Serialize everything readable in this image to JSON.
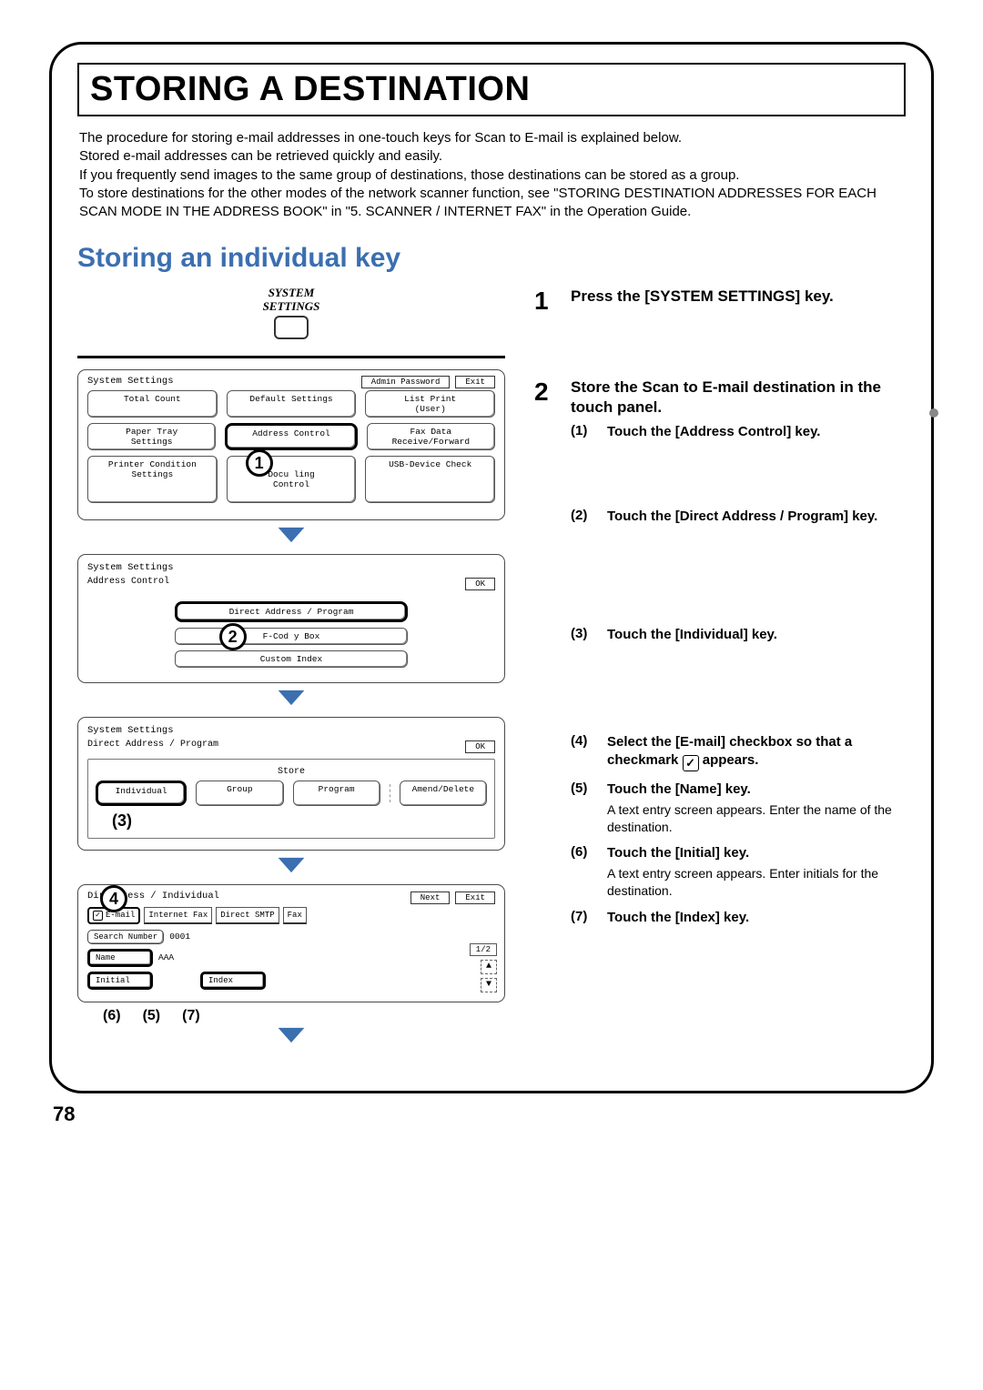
{
  "page": {
    "number": "78",
    "title": "STORING A DESTINATION",
    "intro": "The procedure for storing e-mail addresses in one-touch keys for Scan to E-mail is explained below.\nStored e-mail addresses can be retrieved quickly and easily.\nIf you frequently send images to the same group of destinations, those destinations can be stored as a group.\nTo store destinations for the other modes of the network scanner function, see \"STORING DESTINATION ADDRESSES FOR EACH SCAN MODE IN THE ADDRESS BOOK\" in \"5. SCANNER / INTERNET FAX\" in the Operation Guide.",
    "section_title": "Storing an individual key"
  },
  "hardware_key": {
    "label_top": "SYSTEM",
    "label_bottom": "SETTINGS"
  },
  "steps": [
    {
      "num": "1",
      "head": "Press the [SYSTEM SETTINGS] key."
    },
    {
      "num": "2",
      "head": "Store the Scan to E-mail destination in the touch panel."
    }
  ],
  "substeps": [
    {
      "lbl": "(1)",
      "bold": "Touch the [Address Control] key."
    },
    {
      "lbl": "(2)",
      "bold": "Touch the [Direct Address / Program] key."
    },
    {
      "lbl": "(3)",
      "bold": "Touch the [Individual] key."
    },
    {
      "lbl": "(4)",
      "bold": "Select the [E-mail] checkbox so that a checkmark          appears.",
      "with_check": true
    },
    {
      "lbl": "(5)",
      "bold": "Touch the [Name] key.",
      "desc": "A text entry screen appears. Enter the name of the destination."
    },
    {
      "lbl": "(6)",
      "bold": "Touch the [Initial] key.",
      "desc": "A text entry screen appears. Enter initials for the destination."
    },
    {
      "lbl": "(7)",
      "bold": "Touch the [Index] key."
    }
  ],
  "panel1": {
    "header": "System Settings",
    "top_btns": [
      "Admin Password",
      "Exit"
    ],
    "rows": [
      [
        "Total Count",
        "Default Settings",
        "List Print\n(User)"
      ],
      [
        "Paper Tray\nSettings",
        "Address Control",
        "Fax Data\nReceive/Forward"
      ],
      [
        "Printer Condition\nSettings",
        "Docu          ling\nControl",
        "USB-Device Check"
      ]
    ],
    "callout": "1"
  },
  "panel2": {
    "header": "System Settings",
    "sub": "Address Control",
    "ok": "OK",
    "items": [
      "Direct Address / Program",
      "F-Cod          y Box",
      "Custom Index"
    ],
    "callout": "2"
  },
  "panel3": {
    "header": "System Settings",
    "sub": "Direct Address / Program",
    "ok": "OK",
    "store": "Store",
    "items": [
      "Individual",
      "Group",
      "Program",
      "Amend/Delete"
    ],
    "callout": "3"
  },
  "panel4": {
    "header": "Dir        ddress / Individual",
    "top_btns": [
      "Next",
      "Exit"
    ],
    "tabs": [
      "E-mail",
      "Internet Fax",
      "Direct SMTP",
      "Fax"
    ],
    "search_lbl": "Search Number",
    "search_val": "0001",
    "name_lbl": "Name",
    "name_val": "AAA",
    "initial_lbl": "Initial",
    "index_lbl": "Index",
    "page_ind": "1/2",
    "callouts": {
      "c4": "4",
      "c5": "5",
      "c6": "6",
      "c7": "7"
    },
    "under_markers": [
      "(6)",
      "(5)",
      "(7)"
    ]
  }
}
